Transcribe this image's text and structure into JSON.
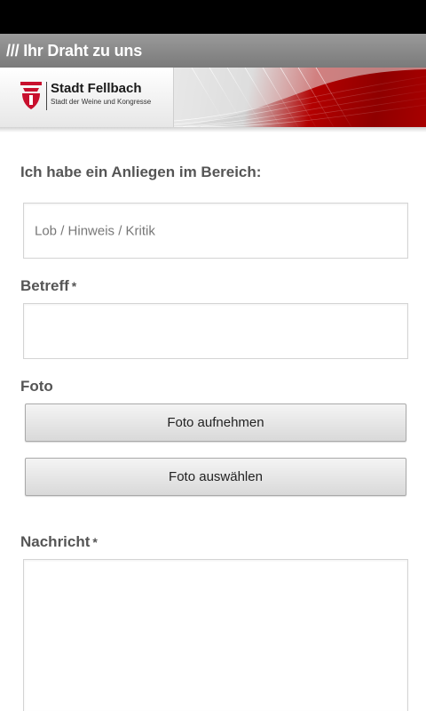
{
  "app": {
    "title": "/// Ihr Draht zu uns"
  },
  "banner": {
    "logo_name": "Stadt Fellbach",
    "logo_subtitle": "Stadt der Weine und Kongresse",
    "accent_color": "#b30000"
  },
  "form": {
    "category_label": "Ich habe ein Anliegen im Bereich:",
    "category_value": "Lob / Hinweis / Kritik",
    "subject_label": "Betreff",
    "subject_required_mark": "*",
    "subject_value": "",
    "photo_label": "Foto",
    "take_photo_button": "Foto aufnehmen",
    "choose_photo_button": "Foto auswählen",
    "message_label": "Nachricht",
    "message_required_mark": "*",
    "message_value": ""
  }
}
